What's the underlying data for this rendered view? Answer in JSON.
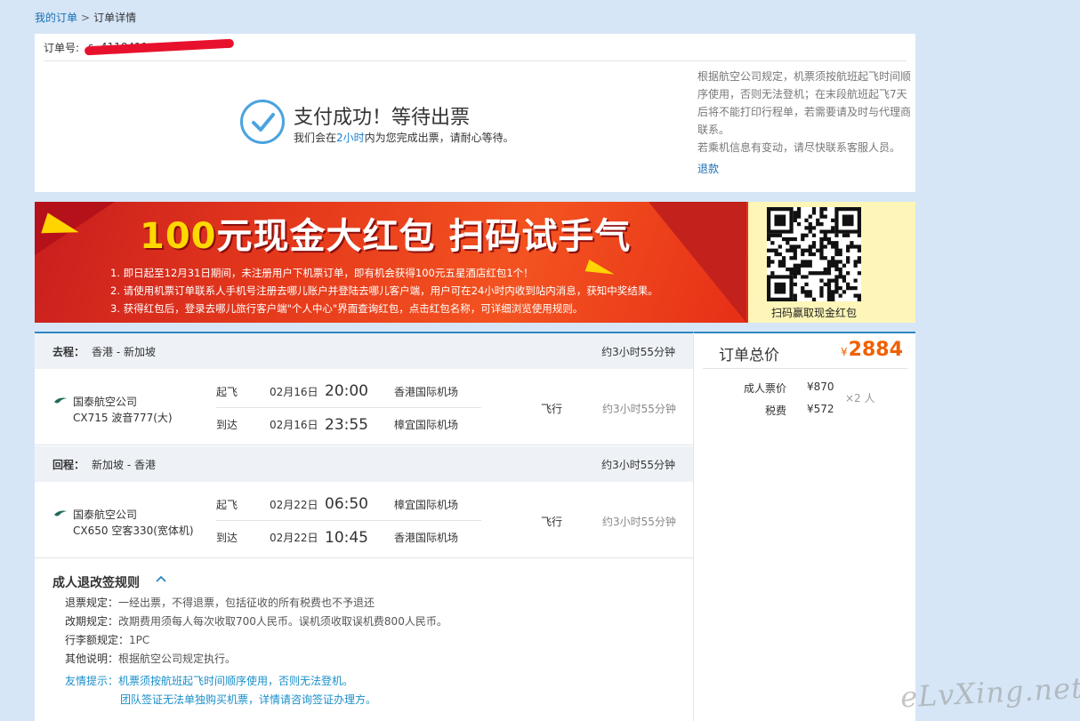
{
  "breadcrumb": {
    "parent": "我的订单",
    "separator": ">",
    "current": "订单详情"
  },
  "order": {
    "label": "订单号:",
    "number": "s..4118411"
  },
  "status": {
    "title": "支付成功！等待出票",
    "sub_prefix": "我们会在",
    "sub_highlight": "2小时",
    "sub_suffix": "内为您完成出票，请耐心等待。"
  },
  "notice": {
    "line1": "根据航空公司规定，机票须按航班起飞时间顺序使用，否则无法登机；在末段航班起飞7天后将不能打印行程单，若需要请及时与代理商联系。",
    "line2": "若乘机信息有变动，请尽快联系客服人员。",
    "refund_link": "退款"
  },
  "banner": {
    "title_num": "100",
    "title_rest": "元现金大红包 扫码试手气",
    "lines": [
      "1. 即日起至12月31日期间，未注册用户下机票订单，即有机会获得100元五星酒店红包1个！",
      "2. 请使用机票订单联系人手机号注册去哪儿账户并登陆去哪儿客户端，用户可在24小时内收到站内消息，获知中奖结果。",
      "3. 获得红包后，登录去哪儿旅行客户端\"个人中心\"界面查询红包，点击红包名称，可详细浏览使用规则。"
    ],
    "qr_caption": "扫码赢取现金红包"
  },
  "segments": [
    {
      "label": "去程：",
      "route": "香港 - 新加坡",
      "duration": "约3小时55分钟",
      "airline": "国泰航空公司",
      "flight": "CX715 波音777(大)",
      "dep": {
        "kind": "起飞",
        "date": "02月16日",
        "time": "20:00",
        "airport": "香港国际机场"
      },
      "arr": {
        "kind": "到达",
        "date": "02月16日",
        "time": "23:55",
        "airport": "樟宜国际机场"
      },
      "type": "飞行",
      "flight_duration": "约3小时55分钟"
    },
    {
      "label": "回程：",
      "route": "新加坡 - 香港",
      "duration": "约3小时55分钟",
      "airline": "国泰航空公司",
      "flight": "CX650 空客330(宽体机)",
      "dep": {
        "kind": "起飞",
        "date": "02月22日",
        "time": "06:50",
        "airport": "樟宜国际机场"
      },
      "arr": {
        "kind": "到达",
        "date": "02月22日",
        "time": "10:45",
        "airport": "香港国际机场"
      },
      "type": "飞行",
      "flight_duration": "约3小时55分钟"
    }
  ],
  "rules": {
    "title": "成人退改签规则",
    "items": [
      {
        "label": "退票规定：",
        "text": "一经出票，不得退票，包括征收的所有税费也不予退还"
      },
      {
        "label": "改期规定：",
        "text": "改期费用须每人每次收取700人民币。误机须收取误机费800人民币。"
      },
      {
        "label": "行李额规定：",
        "text": "1PC"
      },
      {
        "label": "其他说明：",
        "text": "根据航空公司规定执行。"
      }
    ],
    "tip_label": "友情提示：",
    "tip_lines": [
      "机票须按航班起飞时间顺序使用，否则无法登机。",
      "团队签证无法单独购买机票，详情请咨询签证办理方。"
    ]
  },
  "price": {
    "label": "订单总价",
    "currency": "¥",
    "total": "2884",
    "adult_label": "成人票价",
    "adult_value": "¥870",
    "tax_label": "税费",
    "tax_value": "¥572",
    "multiplier": "×2 人"
  },
  "watermark": "eLvXing.net",
  "colors": {
    "accent": "#2e86c1",
    "price": "#f06000",
    "link": "#1a6fb5",
    "banner_red": "#e63a1c",
    "banner_yellow": "#ffd800"
  }
}
